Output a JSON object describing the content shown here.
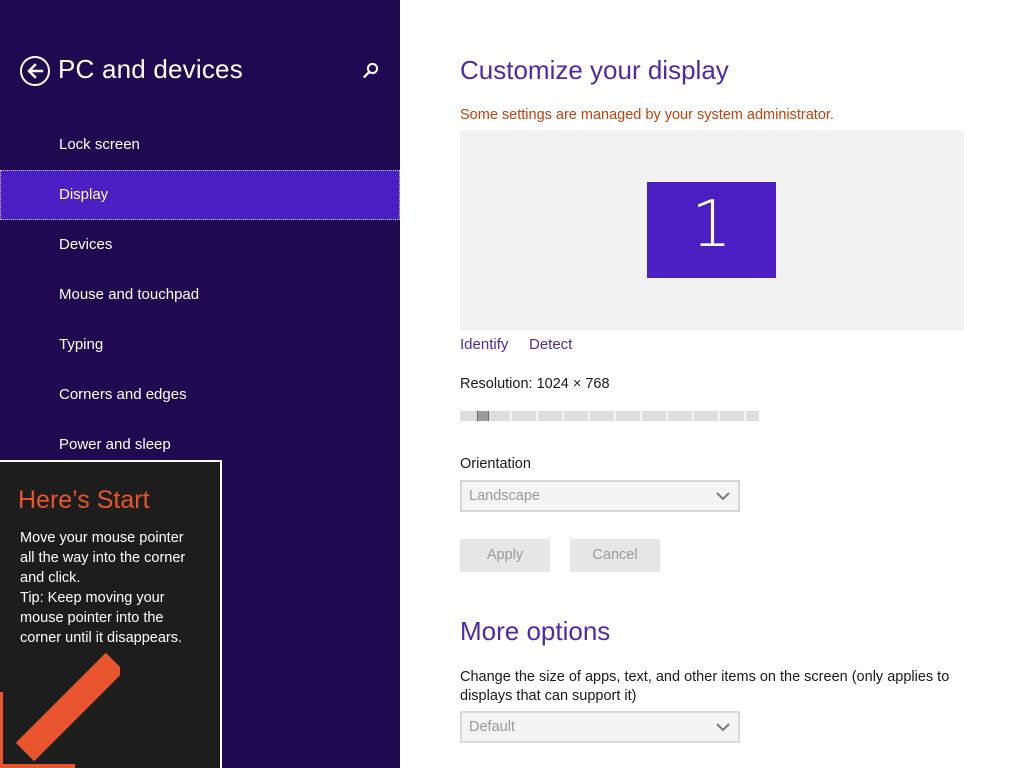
{
  "left_pane": {
    "title": "PC and devices",
    "nav_items": [
      {
        "label": "Lock screen",
        "selected": false
      },
      {
        "label": "Display",
        "selected": true
      },
      {
        "label": "Devices",
        "selected": false
      },
      {
        "label": "Mouse and touchpad",
        "selected": false
      },
      {
        "label": "Typing",
        "selected": false
      },
      {
        "label": "Corners and edges",
        "selected": false
      },
      {
        "label": "Power and sleep",
        "selected": false
      }
    ],
    "icons": {
      "back": "back-arrow-icon",
      "search": "search-icon"
    }
  },
  "start_tip": {
    "title": "Here’s Start",
    "lines": [
      "Move your mouse pointer",
      "all the way into the corner",
      "and click.",
      "Tip: Keep moving your",
      "mouse pointer into the",
      "corner until it disappears."
    ],
    "arrow_color": "#e6552b"
  },
  "main": {
    "title": "Customize your display",
    "admin_notice": "Some settings are managed by your system administrator.",
    "monitor_number": "1",
    "identify_label": "Identify",
    "detect_label": "Detect",
    "resolution_label": "Resolution: 1024 × 768",
    "resolution_slider_level": 0.06,
    "orientation_label": "Orientation",
    "orientation_value": "Landscape",
    "apply_label": "Apply",
    "cancel_label": "Cancel",
    "more_options_title": "More options",
    "scale_description": "Change the size of apps, text, and other items on the screen (only applies to displays that can support it)",
    "scale_value": "Default"
  },
  "colors": {
    "pane_background": "#1f0a52",
    "accent": "#4a1fc4",
    "heading": "#4a2bb0",
    "warning": "#c2410c"
  }
}
